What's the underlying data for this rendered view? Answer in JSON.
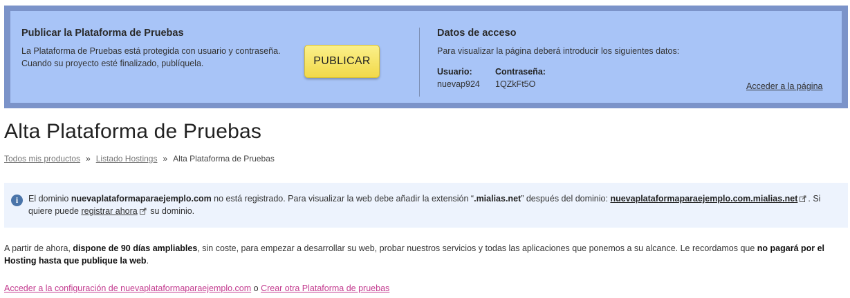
{
  "banner": {
    "publish_title": "Publicar la Plataforma de Pruebas",
    "publish_desc_line1": "La Plataforma de Pruebas está protegida con usuario y contraseña.",
    "publish_desc_line2": "Cuando su proyecto esté finalizado, publíquela.",
    "publish_button": "PUBLICAR",
    "access_title": "Datos de acceso",
    "access_desc": "Para visualizar la página deberá introducir los siguientes datos:",
    "user_label": "Usuario:",
    "user_value": "nuevap924",
    "password_label": "Contraseña:",
    "password_value": "1QZkFt5O",
    "access_link": "Acceder a la página"
  },
  "page_title": "Alta Plataforma de Pruebas",
  "breadcrumb": {
    "items": [
      "Todos mis productos",
      "Listado Hostings",
      "Alta Plataforma de Pruebas"
    ],
    "separator": "»"
  },
  "info": {
    "icon": "info-icon",
    "t1": "El dominio ",
    "domain": "nuevaplataformaparaejemplo.com",
    "t2": " no está registrado. Para visualizar la web debe añadir la extensión “",
    "extension": ".mialias.net",
    "t3": "” después del dominio: ",
    "alias_link": "nuevaplataformaparaejemplo.com.mialias.net",
    "t4": ". Si quiere puede ",
    "register_link": "registrar ahora",
    "t5": " su dominio."
  },
  "paragraph": {
    "t1": "A partir de ahora, ",
    "b1": "dispone de 90 días ampliables",
    "t2": ", sin coste, para empezar a desarrollar su web, probar nuestros servicios y todas las aplicaciones que ponemos a su alcance. Le recordamos que ",
    "b2": "no pagará por el Hosting hasta que publique la web",
    "t3": "."
  },
  "bottom": {
    "config_link": "Acceder a la configuración de nuevaplataformaparaejemplo.com",
    "joiner": " o ",
    "create_link": "Crear otra Plataforma de pruebas"
  },
  "colors": {
    "banner_border": "#7b93c9",
    "banner_bg": "#a8c4f7",
    "button": "#f4e262",
    "info_bg": "#edf3fd",
    "link_pink": "#c33b8f"
  }
}
